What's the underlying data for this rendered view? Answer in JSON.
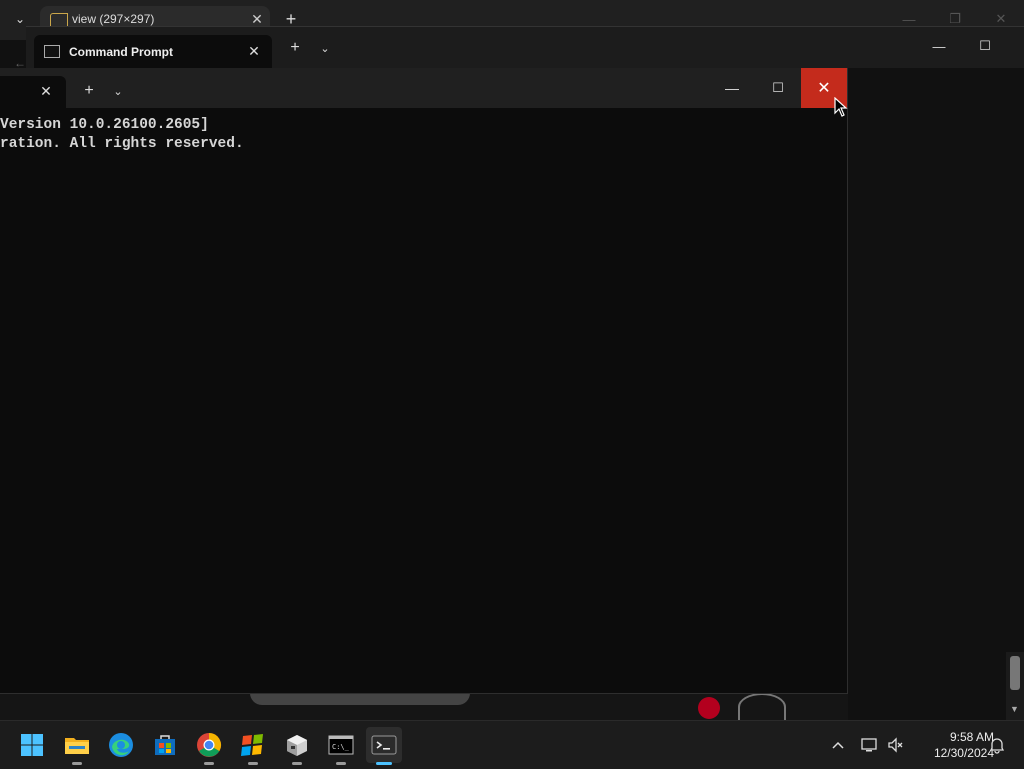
{
  "browser": {
    "tab_title": "view (297×297)",
    "tab_dropdown_icon": "chevron-down-icon",
    "new_tab_icon": "plus-icon"
  },
  "terminal_back": {
    "tab_title": "Command Prompt",
    "tab_icon": "cmd-icon"
  },
  "terminal": {
    "lines": [
      "Version 10.0.26100.2605]",
      "ration. All rights reserved."
    ],
    "close_color": "#c42b1c"
  },
  "taskbar": {
    "items": [
      {
        "name": "start-button",
        "icon": "windows-logo-icon"
      },
      {
        "name": "file-explorer",
        "icon": "folder-icon"
      },
      {
        "name": "edge",
        "icon": "edge-icon"
      },
      {
        "name": "microsoft-store",
        "icon": "store-icon"
      },
      {
        "name": "chrome",
        "icon": "chrome-icon"
      },
      {
        "name": "paint",
        "icon": "paint-icon"
      },
      {
        "name": "package-app",
        "icon": "box-icon"
      },
      {
        "name": "command-prompt",
        "icon": "cmd-icon"
      },
      {
        "name": "terminal",
        "icon": "terminal-icon"
      }
    ],
    "time": "9:58 AM",
    "date": "12/30/2024"
  }
}
